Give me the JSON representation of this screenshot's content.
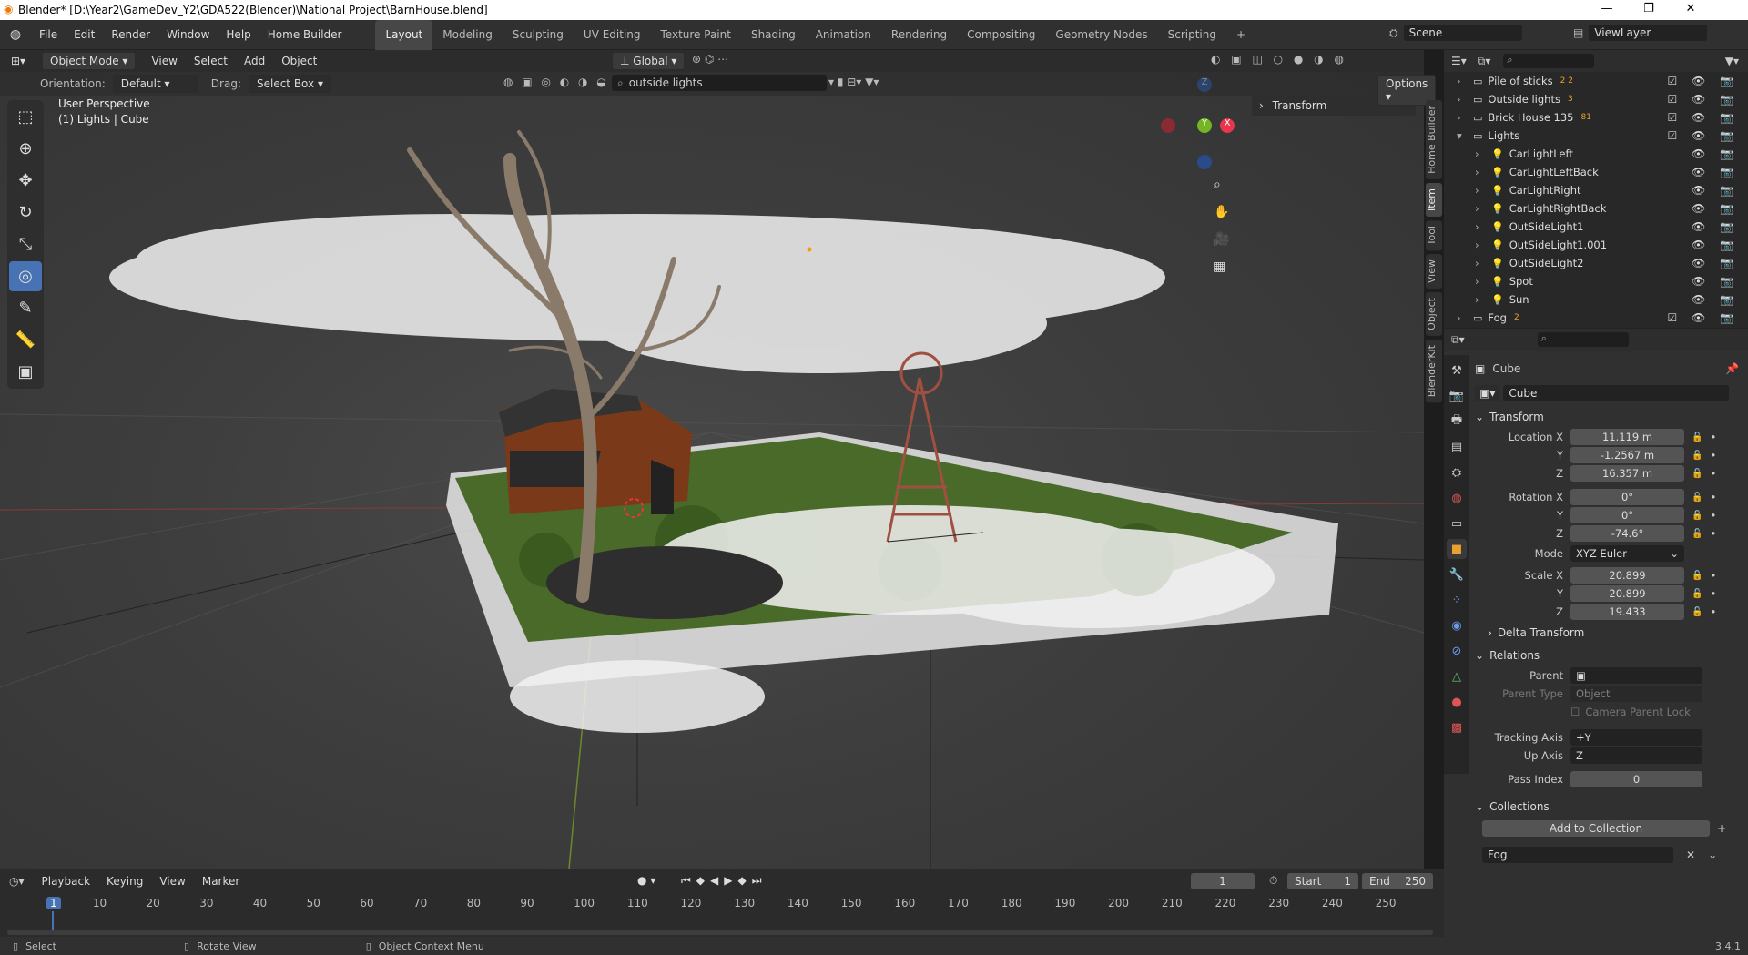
{
  "window": {
    "title": "Blender* [D:\\Year2\\GameDev_Y2\\GDA522(Blender)\\National Project\\BarnHouse.blend]",
    "min": "—",
    "max": "❐",
    "close": "✕"
  },
  "menu": [
    "File",
    "Edit",
    "Render",
    "Window",
    "Help",
    "Home Builder"
  ],
  "workspaces": [
    "Layout",
    "Modeling",
    "Sculpting",
    "UV Editing",
    "Texture Paint",
    "Shading",
    "Animation",
    "Rendering",
    "Compositing",
    "Geometry Nodes",
    "Scripting",
    "+"
  ],
  "scene": {
    "name": "Scene",
    "view_layer": "ViewLayer"
  },
  "viewport": {
    "mode": "Object Mode",
    "menus": [
      "View",
      "Select",
      "Add",
      "Object"
    ],
    "transform_orientation": "Global",
    "orientation_label": "Orientation:",
    "orientation_value": "Default",
    "drag_label": "Drag:",
    "drag_value": "Select Box",
    "search_value": "outside lights",
    "options": "Options",
    "info_line1": "User Perspective",
    "info_line2": "(1) Lights | Cube",
    "sidebar_panel": "Transform",
    "side_tabs": [
      "Home Builder",
      "Item",
      "Tool",
      "View",
      "Object",
      "BlenderKit"
    ]
  },
  "outliner": {
    "rows": [
      {
        "name": "Pile of sticks",
        "indent": 0,
        "expanded": false,
        "type": "collection",
        "badge": "2 2"
      },
      {
        "name": "Outside lights",
        "indent": 0,
        "expanded": false,
        "type": "collection",
        "badge": "3"
      },
      {
        "name": "Brick House 135",
        "indent": 0,
        "expanded": false,
        "type": "collection",
        "badge": "81"
      },
      {
        "name": "Lights",
        "indent": 0,
        "expanded": true,
        "type": "collection",
        "badge": ""
      },
      {
        "name": "CarLightLeft",
        "indent": 1,
        "expanded": false,
        "type": "light",
        "badge": ""
      },
      {
        "name": "CarLightLeftBack",
        "indent": 1,
        "expanded": false,
        "type": "light",
        "badge": ""
      },
      {
        "name": "CarLightRight",
        "indent": 1,
        "expanded": false,
        "type": "light",
        "badge": ""
      },
      {
        "name": "CarLightRightBack",
        "indent": 1,
        "expanded": false,
        "type": "light",
        "badge": ""
      },
      {
        "name": "OutSideLight1",
        "indent": 1,
        "expanded": false,
        "type": "light",
        "badge": ""
      },
      {
        "name": "OutSideLight1.001",
        "indent": 1,
        "expanded": false,
        "type": "light",
        "badge": ""
      },
      {
        "name": "OutSideLight2",
        "indent": 1,
        "expanded": false,
        "type": "light",
        "badge": ""
      },
      {
        "name": "Spot",
        "indent": 1,
        "expanded": false,
        "type": "light",
        "badge": ""
      },
      {
        "name": "Sun",
        "indent": 1,
        "expanded": false,
        "type": "light",
        "badge": ""
      },
      {
        "name": "Fog",
        "indent": 0,
        "expanded": false,
        "type": "collection",
        "badge": "2"
      }
    ]
  },
  "properties": {
    "object_name": "Cube",
    "data_name": "Cube",
    "transform_header": "Transform",
    "location": [
      {
        "label": "Location X",
        "value": "11.119 m"
      },
      {
        "label": "Y",
        "value": "-1.2567 m"
      },
      {
        "label": "Z",
        "value": "16.357 m"
      }
    ],
    "rotation": [
      {
        "label": "Rotation X",
        "value": "0°"
      },
      {
        "label": "Y",
        "value": "0°"
      },
      {
        "label": "Z",
        "value": "-74.6°"
      }
    ],
    "mode_label": "Mode",
    "mode_value": "XYZ Euler",
    "scale": [
      {
        "label": "Scale X",
        "value": "20.899"
      },
      {
        "label": "Y",
        "value": "20.899"
      },
      {
        "label": "Z",
        "value": "19.433"
      }
    ],
    "delta_transform": "Delta Transform",
    "relations_header": "Relations",
    "parent_label": "Parent",
    "parent_type_label": "Parent Type",
    "parent_type_value": "Object",
    "camera_parent_lock": "Camera Parent Lock",
    "tracking_axis_label": "Tracking Axis",
    "tracking_axis_value": "+Y",
    "up_axis_label": "Up Axis",
    "up_axis_value": "Z",
    "pass_index_label": "Pass Index",
    "pass_index_value": "0",
    "collections_header": "Collections",
    "add_to_collection": "Add to Collection",
    "collection_name": "Fog"
  },
  "timeline": {
    "menus": [
      "Playback",
      "Keying",
      "View",
      "Marker"
    ],
    "current_frame": "1",
    "start_label": "Start",
    "start_value": "1",
    "end_label": "End",
    "end_value": "250",
    "ticks": [
      "1",
      "10",
      "20",
      "30",
      "40",
      "50",
      "60",
      "70",
      "80",
      "90",
      "100",
      "110",
      "120",
      "130",
      "140",
      "150",
      "160",
      "170",
      "180",
      "190",
      "200",
      "210",
      "220",
      "230",
      "240",
      "250"
    ]
  },
  "statusbar": {
    "select": "Select",
    "rotate": "Rotate View",
    "context": "Object Context Menu",
    "version": "3.4.1"
  }
}
